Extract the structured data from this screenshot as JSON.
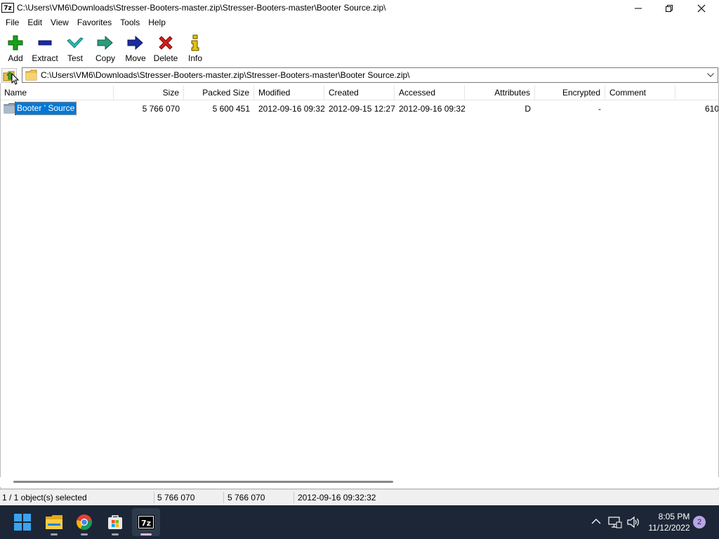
{
  "window": {
    "app_icon_text": "7z",
    "title": "C:\\Users\\VM6\\Downloads\\Stresser-Booters-master.zip\\Stresser-Booters-master\\Booter  Source.zip\\"
  },
  "menu": [
    "File",
    "Edit",
    "View",
    "Favorites",
    "Tools",
    "Help"
  ],
  "toolbar": [
    {
      "label": "Add",
      "icon": "plus-icon",
      "color": "#17a317"
    },
    {
      "label": "Extract",
      "icon": "minus-icon",
      "color": "#1c2aa8"
    },
    {
      "label": "Test",
      "icon": "check-icon",
      "color": "#2bb0a8"
    },
    {
      "label": "Copy",
      "icon": "copy-arrow-icon",
      "color": "#2a9d7c"
    },
    {
      "label": "Move",
      "icon": "move-arrow-icon",
      "color": "#1a2d9c"
    },
    {
      "label": "Delete",
      "icon": "delete-x-icon",
      "color": "#d41e1e"
    },
    {
      "label": "Info",
      "icon": "info-icon",
      "color": "#c8a800"
    }
  ],
  "address": {
    "path": "C:\\Users\\VM6\\Downloads\\Stresser-Booters-master.zip\\Stresser-Booters-master\\Booter  Source.zip\\"
  },
  "columns": [
    "Name",
    "Size",
    "Packed Size",
    "Modified",
    "Created",
    "Accessed",
    "Attributes",
    "Encrypted",
    "Comment",
    ""
  ],
  "rows": [
    {
      "name": "Booter ' Source",
      "size": "5 766 070",
      "packed_size": "5 600 451",
      "modified": "2012-09-16 09:32",
      "created": "2012-09-15 12:27",
      "accessed": "2012-09-16 09:32",
      "attributes": "D",
      "encrypted": "-",
      "comment": "",
      "extra": "610"
    }
  ],
  "status": {
    "selection": "1 / 1 object(s) selected",
    "size": "5 766 070",
    "packed": "5 766 070",
    "modified": "2012-09-16 09:32:32"
  },
  "taskbar": {
    "apps": [
      "start-icon",
      "file-explorer-icon",
      "chrome-icon",
      "store-icon",
      "7zip-icon"
    ],
    "time": "8:05 PM",
    "date": "11/12/2022",
    "notifications": "2"
  },
  "colors": {
    "selection": "#0078d7",
    "taskbar": "#1c2636"
  }
}
